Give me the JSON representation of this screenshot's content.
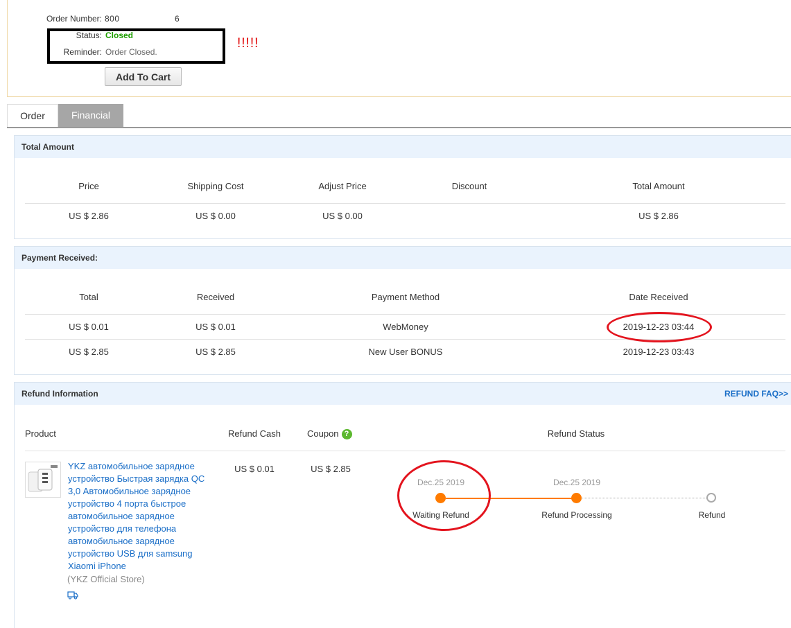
{
  "header": {
    "order_number_label": "Order Number:",
    "order_number_prefix": "800",
    "order_number_suffix": "6",
    "status_label": "Status:",
    "status_value": "Closed",
    "reminder_label": "Reminder:",
    "reminder_value": "Order Closed.",
    "annotation_text": "!!!!!",
    "add_to_cart_label": "Add To Cart"
  },
  "tabs": [
    {
      "label": "Order",
      "active": false
    },
    {
      "label": "Financial",
      "active": true
    }
  ],
  "total_amount": {
    "title": "Total Amount",
    "columns": [
      "Price",
      "Shipping Cost",
      "Adjust Price",
      "Discount",
      "Total Amount"
    ],
    "row": [
      "US $ 2.86",
      "US $ 0.00",
      "US $ 0.00",
      "",
      "US $ 2.86"
    ]
  },
  "payment_received": {
    "title": "Payment Received:",
    "columns": [
      "Total",
      "Received",
      "Payment Method",
      "Date Received"
    ],
    "rows": [
      [
        "US $ 0.01",
        "US $ 0.01",
        "WebMoney",
        "2019-12-23 03:44"
      ],
      [
        "US $ 2.85",
        "US $ 2.85",
        "New User BONUS",
        "2019-12-23 03:43"
      ]
    ]
  },
  "refund": {
    "title": "Refund Information",
    "faq_link": "REFUND FAQ>>",
    "columns": {
      "product": "Product",
      "refund_cash": "Refund Cash",
      "coupon": "Coupon",
      "refund_status": "Refund Status"
    },
    "coupon_help_glyph": "?",
    "product_name": "YKZ автомобильное зарядное устройство Быстрая зарядка QC 3,0 Автомобильное зарядное устройство 4 порта быстрое автомобильное зарядное устройство для телефона автомобильное зарядное устройство USB для samsung Xiaomi iPhone",
    "store": "(YKZ Official Store)",
    "refund_cash": "US $ 0.01",
    "coupon_value": "US $ 2.85",
    "steps": [
      {
        "date": "Dec.25 2019",
        "label": "Waiting Refund",
        "state": "done"
      },
      {
        "date": "Dec.25 2019",
        "label": "Refund Processing",
        "state": "done"
      },
      {
        "date": "",
        "label": "Refund",
        "state": "pending"
      }
    ]
  },
  "colors": {
    "accent_orange": "#ff7b00",
    "link_blue": "#1a6ec7",
    "status_green": "#1e9e00",
    "annotation_red": "#e3141e",
    "panel_header_bg": "#eaf3fd"
  }
}
